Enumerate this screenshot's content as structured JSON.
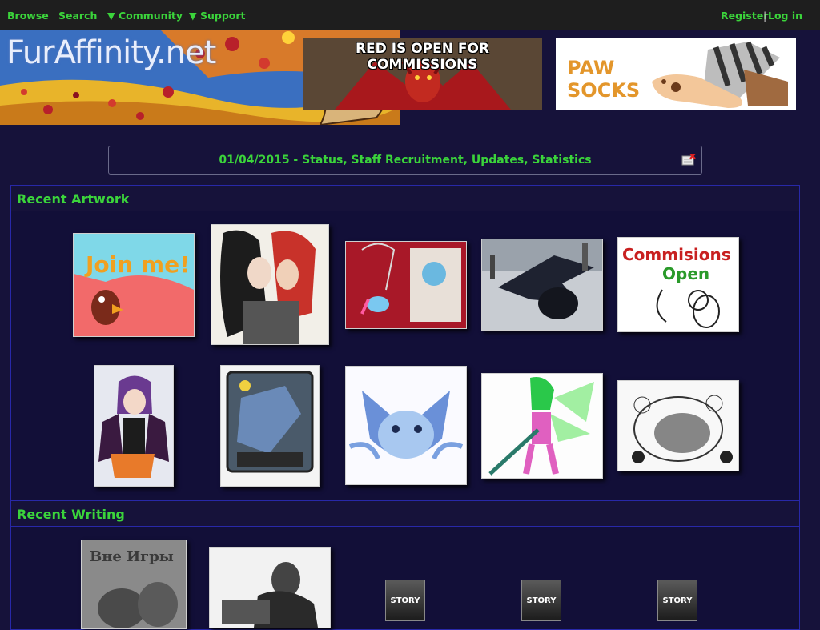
{
  "nav": {
    "browse": "Browse",
    "search": "Search",
    "community": "▼ Community",
    "support": "▼ Support",
    "register": "Register",
    "separator": "|",
    "login": "Log in"
  },
  "header": {
    "logo_text": "FurAffinity.net",
    "banner_commissions": "RED IS OPEN FOR COMMISSIONS",
    "banner_socks_line1": "PAW",
    "banner_socks_line2": "SOCKS"
  },
  "news": {
    "headline": "01/04/2015 - Status, Staff Recruitment, Updates, Statistics"
  },
  "artwork": {
    "title": "Recent Artwork",
    "thumb_texts": {
      "join_me": "Join me!",
      "commissions_line1": "Commisions",
      "commissions_line2": "Open"
    }
  },
  "writing": {
    "title": "Recent Writing",
    "book_title": "Вне Игры",
    "story_label": "STORY"
  },
  "colors": {
    "accent_green": "#3bd43b",
    "page_bg": "#16123a",
    "section_border": "#2828a8"
  }
}
